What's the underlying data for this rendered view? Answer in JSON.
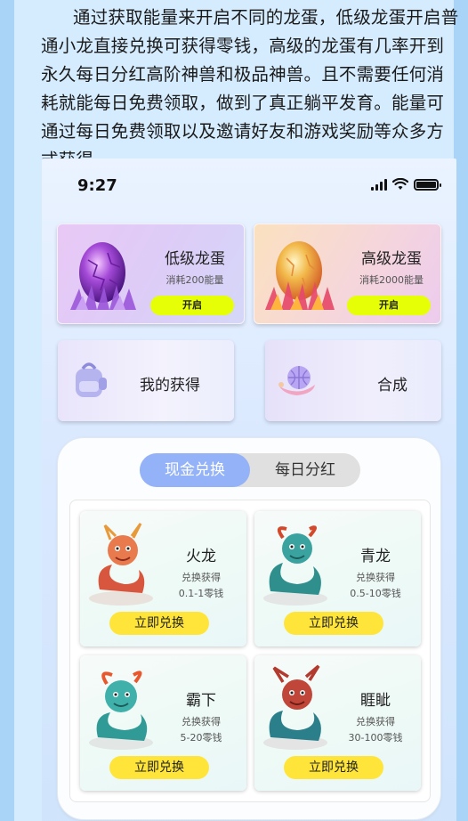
{
  "intro_text": "通过获取能量来开启不同的龙蛋，低级龙蛋开启普通小龙直接兑换可获得零钱，高级的龙蛋有几率开到永久每日分红高阶神兽和极品神兽。且不需要任何消耗就能每日免费领取，做到了真正躺平发育。能量可通过每日免费领取以及邀请好友和游戏奖励等众多方式获得。",
  "status": {
    "time": "9:27"
  },
  "eggs": [
    {
      "title": "低级龙蛋",
      "cost": "消耗200能量",
      "button": "开启",
      "icon": "purple-egg-icon"
    },
    {
      "title": "高级龙蛋",
      "cost": "消耗2000能量",
      "button": "开启",
      "icon": "golden-egg-icon"
    }
  ],
  "actions": {
    "mine": {
      "label": "我的获得",
      "icon": "backpack-icon"
    },
    "synth": {
      "label": "合成",
      "icon": "airship-icon"
    }
  },
  "tabs": {
    "active": "现金兑换",
    "inactive": "每日分红"
  },
  "dragons": [
    {
      "name": "火龙",
      "line1": "兑换获得",
      "line2": "0.1-1零钱",
      "button": "立即兑换"
    },
    {
      "name": "青龙",
      "line1": "兑换获得",
      "line2": "0.5-10零钱",
      "button": "立即兑换"
    },
    {
      "name": "霸下",
      "line1": "兑换获得",
      "line2": "5-20零钱",
      "button": "立即兑换"
    },
    {
      "name": "睚眦",
      "line1": "兑换获得",
      "line2": "30-100零钱",
      "button": "立即兑换"
    }
  ],
  "colors": {
    "accent_yellow": "#ffe53a",
    "open_button": "#e6ff06",
    "tab_active": "#93b2f7"
  }
}
